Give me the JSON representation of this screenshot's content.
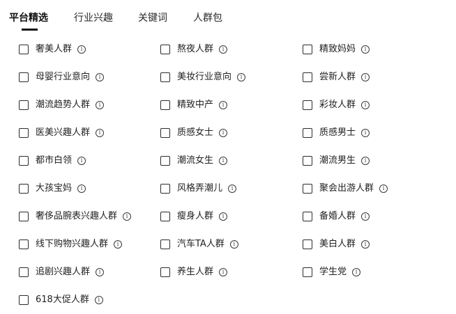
{
  "tabs": [
    {
      "label": "平台精选",
      "active": true
    },
    {
      "label": "行业兴趣",
      "active": false
    },
    {
      "label": "关键词",
      "active": false
    },
    {
      "label": "人群包",
      "active": false
    }
  ],
  "options": [
    {
      "label": "奢美人群",
      "checked": false
    },
    {
      "label": "熬夜人群",
      "checked": false
    },
    {
      "label": "精致妈妈",
      "checked": false
    },
    {
      "label": "母婴行业意向",
      "checked": false
    },
    {
      "label": "美妆行业意向",
      "checked": false
    },
    {
      "label": "尝新人群",
      "checked": false
    },
    {
      "label": "潮流趋势人群",
      "checked": false
    },
    {
      "label": "精致中产",
      "checked": false
    },
    {
      "label": "彩妆人群",
      "checked": false
    },
    {
      "label": "医美兴趣人群",
      "checked": false
    },
    {
      "label": "质感女士",
      "checked": false
    },
    {
      "label": "质感男士",
      "checked": false
    },
    {
      "label": "都市白领",
      "checked": false
    },
    {
      "label": "潮流女生",
      "checked": false
    },
    {
      "label": "潮流男生",
      "checked": false
    },
    {
      "label": "大孩宝妈",
      "checked": false
    },
    {
      "label": "风格弄潮儿",
      "checked": false
    },
    {
      "label": "聚会出游人群",
      "checked": false
    },
    {
      "label": "奢侈品腕表兴趣人群",
      "checked": false
    },
    {
      "label": "瘦身人群",
      "checked": false
    },
    {
      "label": "备婚人群",
      "checked": false
    },
    {
      "label": "线下购物兴趣人群",
      "checked": false
    },
    {
      "label": "汽车TA人群",
      "checked": false
    },
    {
      "label": "美白人群",
      "checked": false
    },
    {
      "label": "追剧兴趣人群",
      "checked": false
    },
    {
      "label": "养生人群",
      "checked": false
    },
    {
      "label": "学生党",
      "checked": false
    },
    {
      "label": "618大促人群",
      "checked": false
    }
  ],
  "icons": {
    "checkbox": "checkbox-icon",
    "info": "info-icon"
  },
  "colors": {
    "text": "#222222",
    "active_tab": "#111111",
    "checkbox_border": "#2b2b2b"
  }
}
